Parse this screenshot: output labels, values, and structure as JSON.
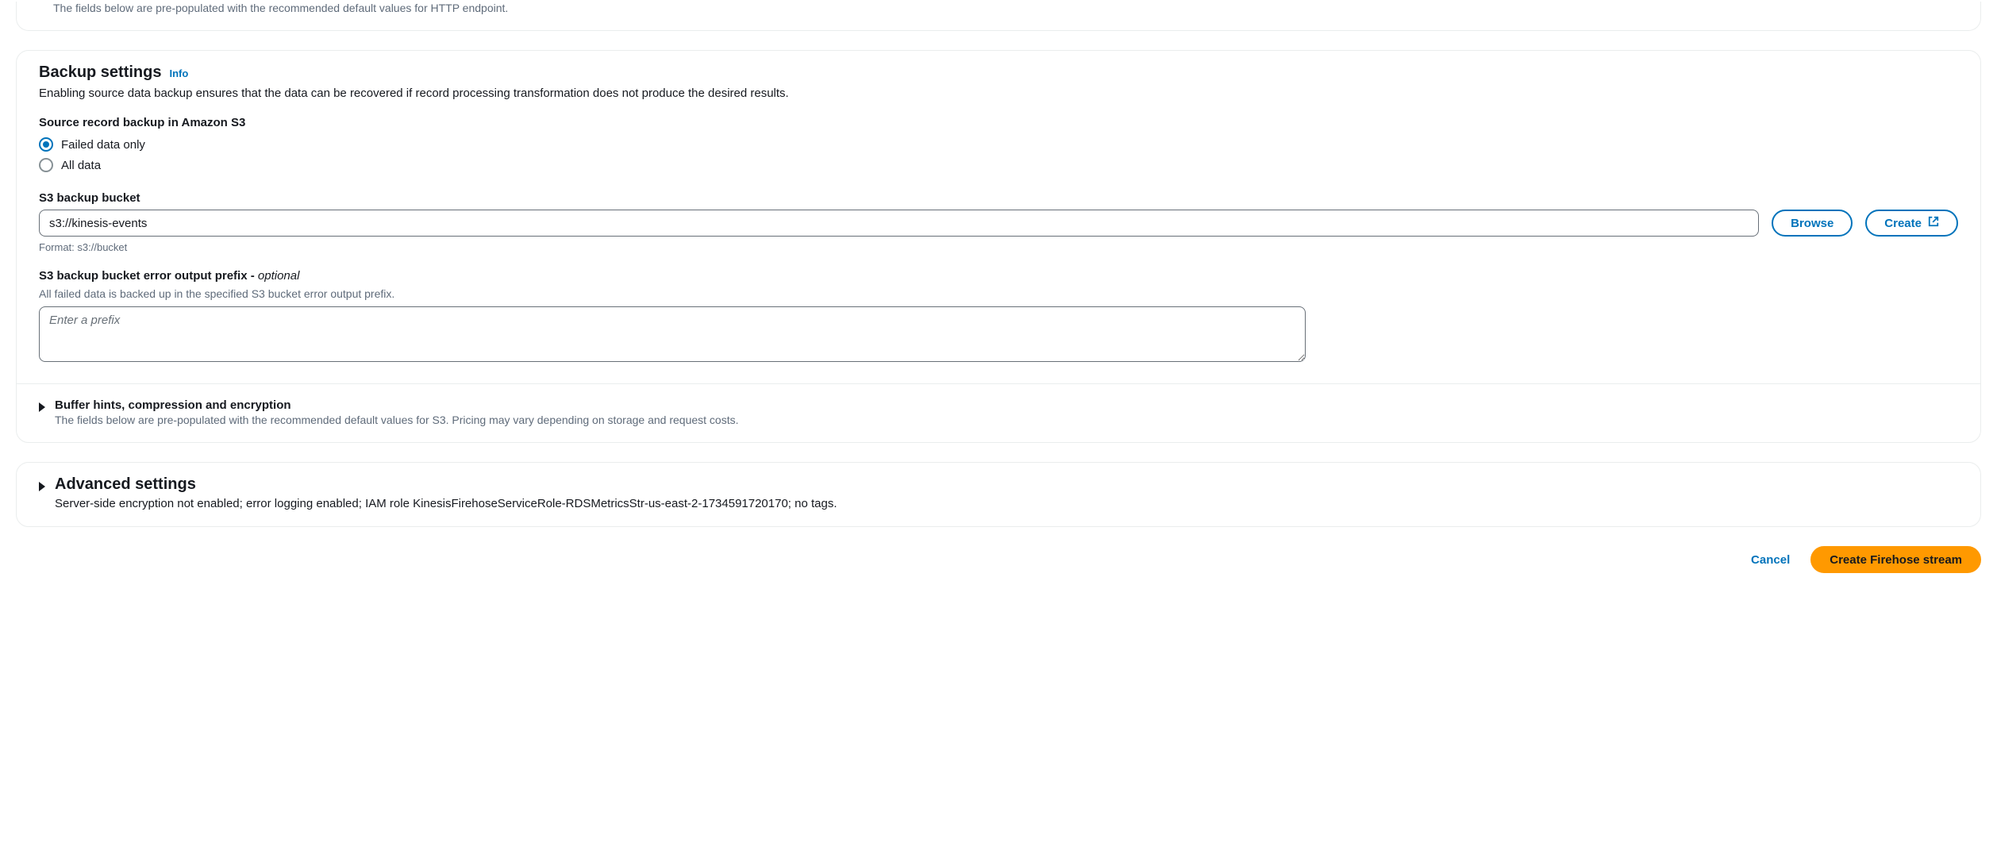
{
  "topPanel": {
    "description": "The fields below are pre-populated with the recommended default values for HTTP endpoint."
  },
  "backup": {
    "title": "Backup settings",
    "infoLabel": "Info",
    "description": "Enabling source data backup ensures that the data can be recovered if record processing transformation does not produce the desired results.",
    "sourceRecordLabel": "Source record backup in Amazon S3",
    "radioFailed": "Failed data only",
    "radioAll": "All data",
    "bucketLabel": "S3 backup bucket",
    "bucketValue": "s3://kinesis-events",
    "bucketHint": "Format: s3://bucket",
    "browseLabel": "Browse",
    "createLabel": "Create",
    "prefixLabel": "S3 backup bucket error output prefix - ",
    "prefixOptional": "optional",
    "prefixDescription": "All failed data is backed up in the specified S3 bucket error output prefix.",
    "prefixPlaceholder": "Enter a prefix",
    "bufferTitle": "Buffer hints, compression and encryption",
    "bufferDescription": "The fields below are pre-populated with the recommended default values for S3. Pricing may vary depending on storage and request costs."
  },
  "advanced": {
    "title": "Advanced settings",
    "description": "Server-side encryption not enabled; error logging enabled; IAM role KinesisFirehoseServiceRole-RDSMetricsStr-us-east-2-1734591720170; no tags."
  },
  "footer": {
    "cancel": "Cancel",
    "create": "Create Firehose stream"
  }
}
